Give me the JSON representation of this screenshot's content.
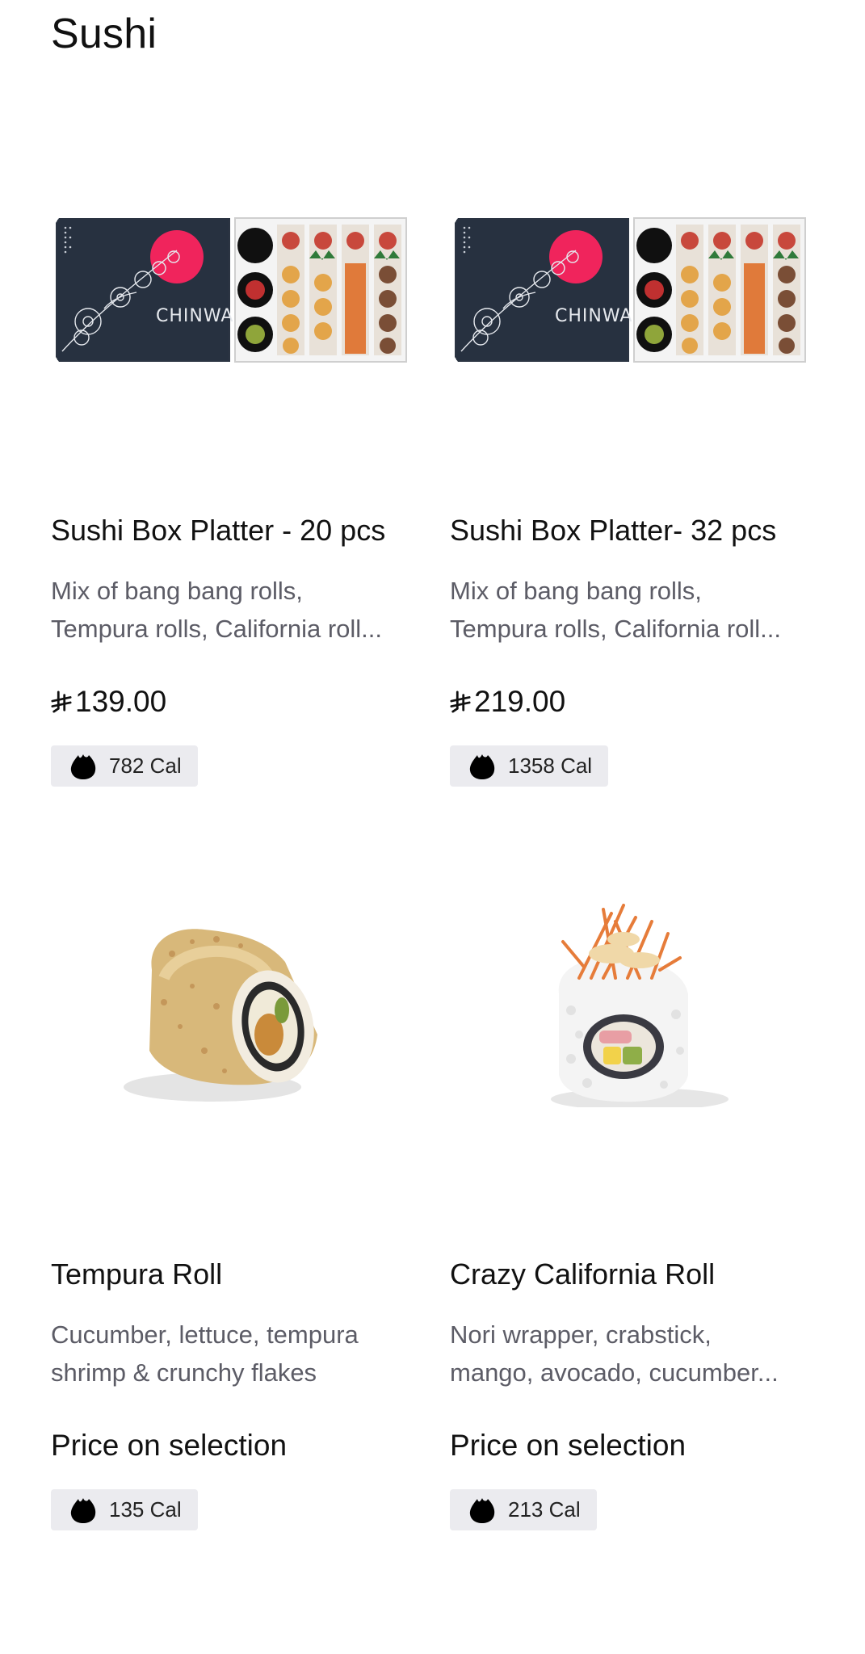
{
  "section": {
    "title": "Sushi"
  },
  "products": [
    {
      "name": "Sushi Box Platter - 20 pcs",
      "desc_line1": "Mix of bang bang rolls,",
      "desc_line2": "Tempura rolls, California roll...",
      "price": "139.00",
      "currency_icon": "riyal-icon",
      "calories": "782 Cal",
      "image": "sushi-box-platter-image"
    },
    {
      "name": "Sushi Box Platter- 32 pcs",
      "desc_line1": "Mix of bang bang rolls,",
      "desc_line2": "Tempura rolls, California roll...",
      "price": "219.00",
      "currency_icon": "riyal-icon",
      "calories": "1358 Cal",
      "image": "sushi-box-platter-image"
    },
    {
      "name": "Tempura Roll",
      "desc_line1": "Cucumber, lettuce, tempura",
      "desc_line2": "shrimp & crunchy flakes",
      "price": "Price on selection",
      "calories": "135 Cal",
      "image": "tempura-roll-image"
    },
    {
      "name": "Crazy California Roll",
      "desc_line1": "Nori wrapper, crabstick,",
      "desc_line2": "mango, avocado, cucumber...",
      "price": "Price on selection",
      "calories": "213 Cal",
      "image": "california-roll-image"
    }
  ],
  "box_brand": "CHINWA",
  "colors": {
    "text": "#111111",
    "muted": "#5c5c66",
    "badge_bg": "#ebebef",
    "box_dark": "#2b3442",
    "accent_red": "#f0245c"
  }
}
